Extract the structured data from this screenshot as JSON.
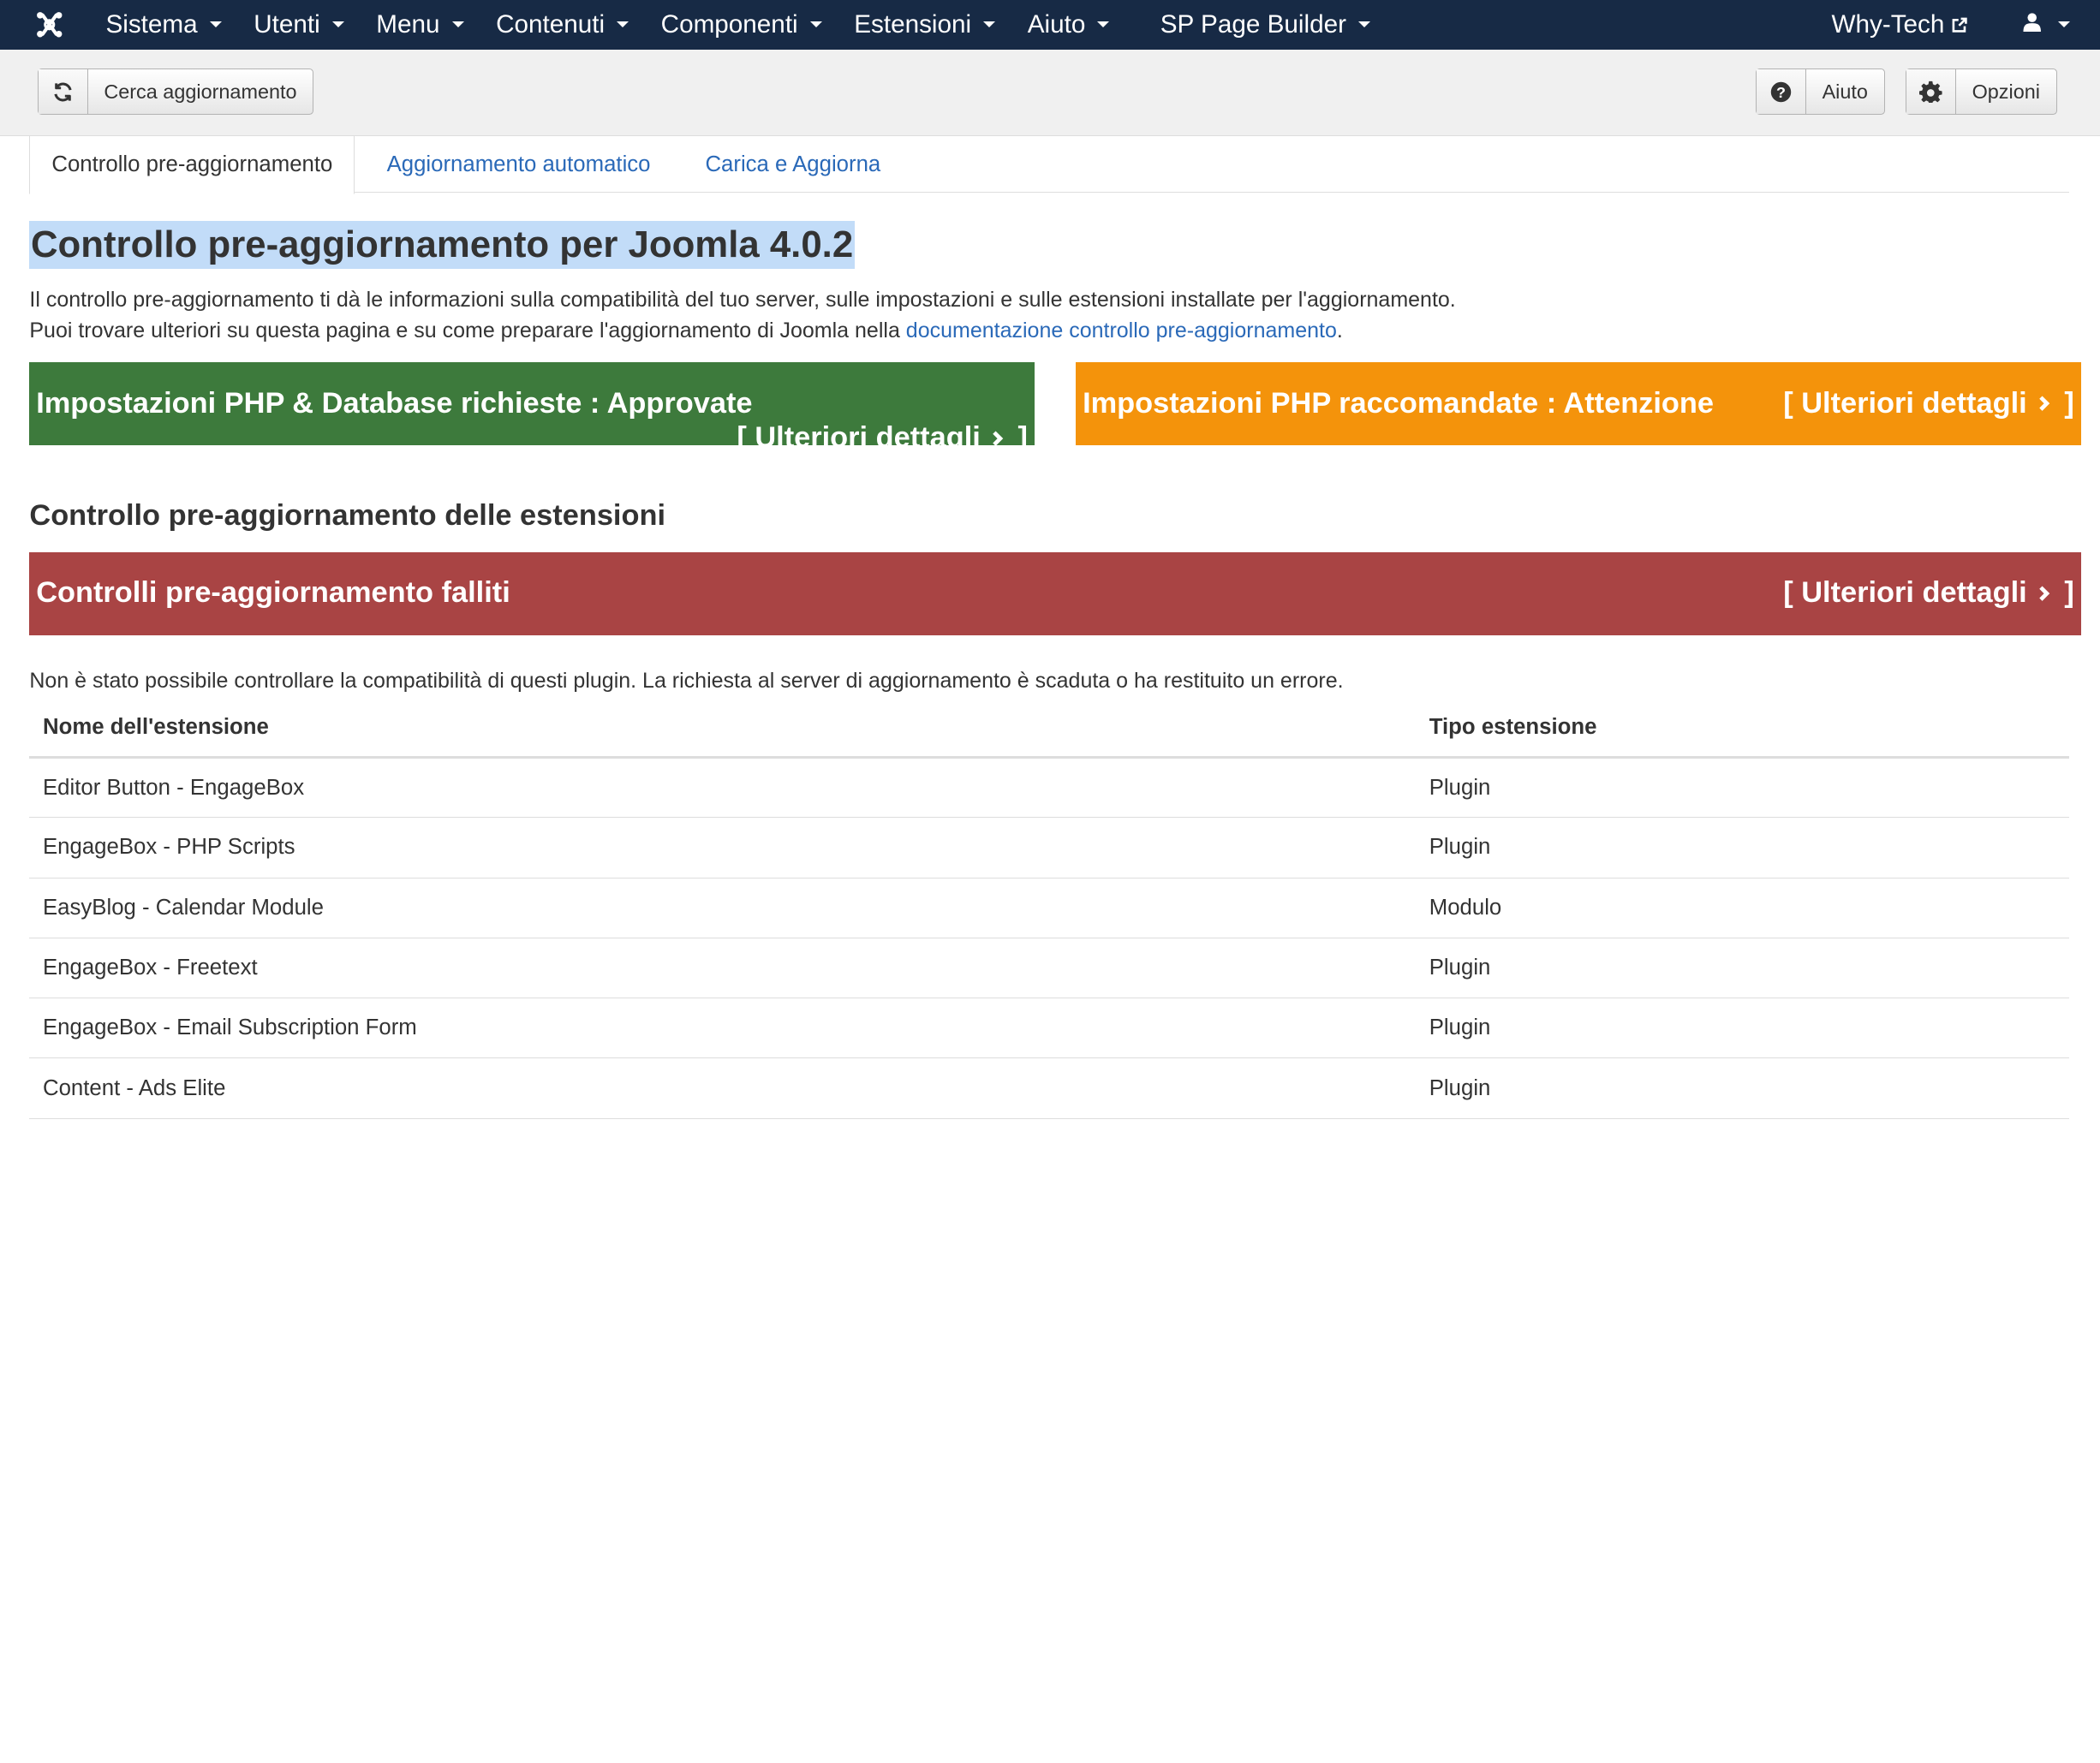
{
  "navbar": {
    "logo_icon": "joomla-logo-icon",
    "menus": [
      "Sistema",
      "Utenti",
      "Menu",
      "Contenuti",
      "Componenti",
      "Estensioni",
      "Aiuto",
      "SP Page Builder"
    ],
    "site_link": "Why-Tech",
    "user_icon": "user-icon"
  },
  "toolbar": {
    "check_updates_label": "Cerca aggiornamento",
    "help_label": "Aiuto",
    "options_label": "Opzioni"
  },
  "tabs": [
    "Controllo pre-aggiornamento",
    "Aggiornamento automatico",
    "Carica e Aggiorna"
  ],
  "main": {
    "title": "Controllo pre-aggiornamento per Joomla 4.0.2",
    "desc_line1": "Il controllo pre-aggiornamento ti dà le informazioni sulla compatibilità del tuo server, sulle impostazioni e sulle estensioni installate per l'aggiornamento.",
    "desc_line2_prefix": "Puoi trovare ulteriori su questa pagina e su come preparare l'aggiornamento di Joomla nella ",
    "desc_link": "documentazione controllo pre-aggiornamento",
    "desc_line2_suffix": "."
  },
  "banners": {
    "php_db": {
      "title": "Impostazioni PHP & Database richieste : Approvate",
      "more_open": "[ Ulteriori dettagli",
      "more_close": "]",
      "color": "#3d7a3c"
    },
    "php_recommended": {
      "title": "Impostazioni PHP raccomandate : Attenzione",
      "more_open": "[ Ulteriori dettagli",
      "more_close": "]",
      "color": "#f4930b"
    },
    "extensions_failed": {
      "title": "Controlli pre-aggiornamento falliti",
      "more_open": "[ Ulteriori dettagli",
      "more_close": "]",
      "color": "#a94444"
    }
  },
  "extensions": {
    "section_title": "Controllo pre-aggiornamento delle estensioni",
    "note": "Non è stato possibile controllare la compatibilità di questi plugin. La richiesta al server di aggiornamento è scaduta o ha restituito un errore.",
    "columns": [
      "Nome dell'estensione",
      "Tipo estensione"
    ],
    "rows": [
      {
        "name": "Editor Button - EngageBox",
        "type": "Plugin"
      },
      {
        "name": "EngageBox - PHP Scripts",
        "type": "Plugin"
      },
      {
        "name": "EasyBlog - Calendar Module",
        "type": "Modulo"
      },
      {
        "name": "EngageBox - Freetext",
        "type": "Plugin"
      },
      {
        "name": "EngageBox - Email Subscription Form",
        "type": "Plugin"
      },
      {
        "name": "Content - Ads Elite",
        "type": "Plugin"
      }
    ]
  }
}
